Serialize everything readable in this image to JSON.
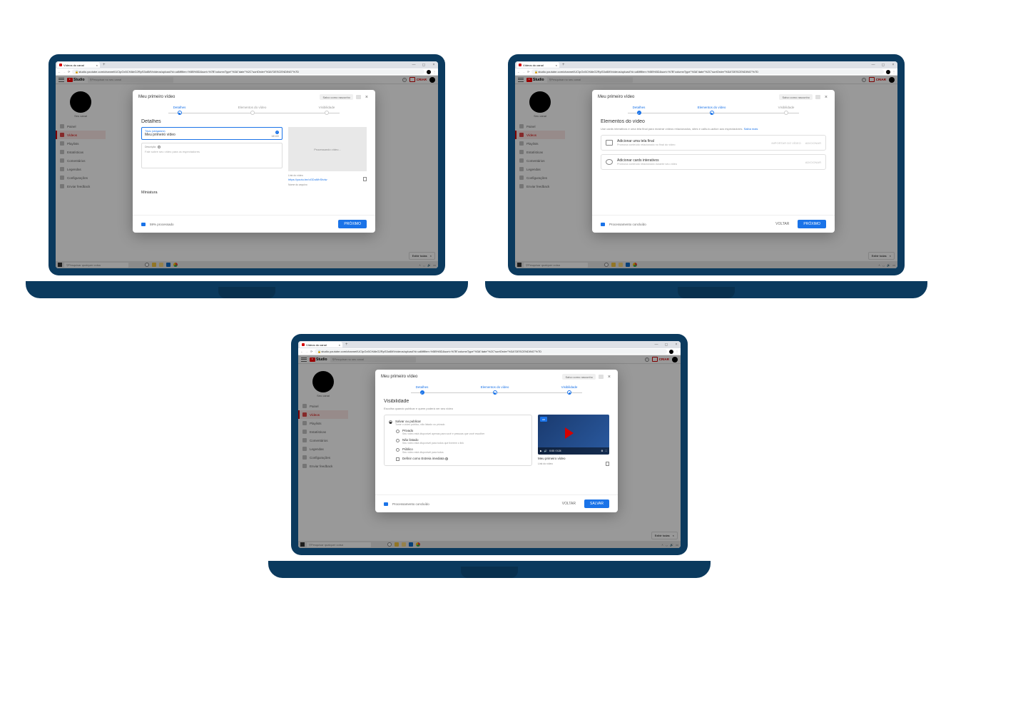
{
  "browser": {
    "tabTitle": "Vídeos do canal",
    "url": "studio.youtube.com/channel/UCIpGx5CHAbG2RpS3o6MVvideos/upload?d=udMfilter=%5B%5D&sort=%7B\"columnType\"%3A\"date\"%2C\"sortOrder\"%3A\"DESCENDING\"%7D",
    "newTab": "+",
    "minimize": "—",
    "maximize": "◻",
    "close": "×",
    "navBack": "←",
    "navForward": "→",
    "navReload": "⟳",
    "menu": "⋮"
  },
  "studio": {
    "logoText": "Studio",
    "searchPlaceholder": "Pesquisar no seu canal",
    "criarLabel": "CRIAR",
    "helpGlyph": "?",
    "channelLabel": "Seu canal",
    "nav": {
      "painel": "Painel",
      "videos": "Vídeos",
      "playlists": "Playlists",
      "estatisticas": "Estatísticas",
      "comentarios": "Comentários",
      "legendas": "Legendas",
      "configuracoes": "Configurações",
      "feedback": "Enviar feedback"
    }
  },
  "dialog": {
    "title": "Meu primeiro vídeo",
    "saveDraftLabel": "Salvo como rascunho",
    "steps": {
      "detalhes": "Detalhes",
      "elementos": "Elementos do vídeo",
      "visibilidade": "Visibilidade"
    },
    "footer": {
      "proxBtn": "PRÓXIMO",
      "voltarBtn": "VOLTAR",
      "salvarBtn": "SALVAR"
    }
  },
  "step1": {
    "sectionTitle": "Detalhes",
    "titleFieldLabel": "Título (obrigatório)",
    "titleFieldValue": "Meu primeiro vídeo",
    "titleCount": "18/100",
    "descLabel": "Descrição",
    "descPlaceholder": "Fale sobre seu vídeo para os espectadores",
    "previewProcessing": "Processando vídeo...",
    "linkLabel": "Link do vídeo",
    "linkValue": "https://youtu.be/oGDuMhShdw",
    "fileLabel": "Nome do arquivo",
    "miniaturaLabel": "Miniatura",
    "processing": "59% processado"
  },
  "step2": {
    "sectionTitle": "Elementos do vídeo",
    "sectionSub": "Use cards interativos e uma tela final para mostrar vídeos relacionados, sites e calls-to-action aos espectadores.",
    "saibaMais": "Saiba mais",
    "card1Title": "Adicionar uma tela final",
    "card1Sub": "Promova conteúdo relacionado no final do vídeo",
    "card1Action1": "IMPORTAR DO VÍDEO",
    "card1Action2": "ADICIONAR",
    "card2Title": "Adicionar cards interativos",
    "card2Sub": "Promova conteúdo relacionado durante seu vídeo",
    "card2Action": "ADICIONAR",
    "processing": "Processamento concluído"
  },
  "step3": {
    "sectionTitle": "Visibilidade",
    "sectionSub": "Escolha quando publicar e quem poderá ver seu vídeo",
    "groupTitle": "Salvar ou publicar",
    "groupSub": "Torne o vídeo público, não listado ou privado",
    "opt1": "Privado",
    "opt1Sub": "Seu vídeo está disponível apenas para você e pessoas que você escolher",
    "opt2": "Não listado",
    "opt2Sub": "Seu vídeo está disponível para todos que tiverem o link",
    "opt3": "Público",
    "opt3Sub": "Seu vídeo está disponível para todos",
    "premiere": "Definir como Estreia imediata",
    "previewTitle": "Meu primeiro vídeo",
    "previewLinkLabel": "Link do vídeo",
    "playTime": "0:00 / 0:24",
    "hdBadge": "HD",
    "processing": "Processamento concluído"
  },
  "taskbar": {
    "searchPlaceholder": "Pesquisar qualquer coisa"
  },
  "chat": {
    "label": "Exibir todas",
    "close": "×"
  }
}
